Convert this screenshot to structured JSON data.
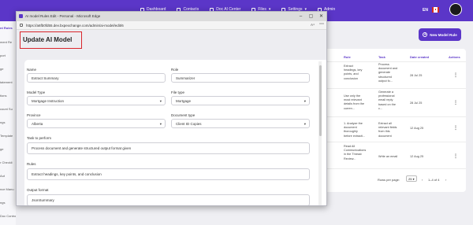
{
  "topnav": {
    "items": [
      "Dashboard",
      "Contacts",
      "Doc AI Center",
      "Files",
      "Settings",
      "Admin"
    ],
    "language": "EN"
  },
  "sidebar": {
    "items": [
      "nt Rules",
      "ment Re",
      "port",
      "ge",
      "tatement",
      "tions",
      "count Su",
      "ngs",
      "Template",
      "ge",
      "r Checkli",
      "Aut",
      "nce Manu",
      "ngs",
      "Doc Control"
    ]
  },
  "main": {
    "new_rule_label": "New Model Rule",
    "columns": [
      "Rule",
      "Task",
      "Date created",
      "Actions"
    ],
    "rows": [
      {
        "rule": "Extract\nheadings, key\npoints, and\nconclusion",
        "task": "Process\ndocument and\ngenerate\nstructured\noutput fo...",
        "date": "28 Jul 25"
      },
      {
        "rule": "Use only the\nmost relevant\ndetails from the\ncurren...",
        "task": "Generate a\nprofessional\nemail reply\nbased on the\nc...",
        "date": "28 Jul 25"
      },
      {
        "rule": "1. Analyze the\ndocument\nthoroughly\nbefore extracti...",
        "task": "Extract all\nrelevant fields\nfrom this\ndocument",
        "date": "12 Aug 25"
      },
      {
        "rule": "Read All\nCommunications\nin the Thread:\nReview...",
        "task": "Write an email",
        "date": "12 Aug 25"
      }
    ],
    "pager": {
      "rows_per_page_label": "Rows per page:",
      "rows_per_page": "25",
      "range": "1–4 of 4"
    }
  },
  "popup": {
    "window_title": "AI model Rules Edit - Personal - Microsoft Edge",
    "url": "https://a6fb0fd55.dev.bxpexchange.com/admin/ai-model/edit/6",
    "reader_label": "A⁴",
    "heading": "Update AI Model",
    "form": {
      "name_label": "Name",
      "name_value": "Extract Summary",
      "role_label": "Role",
      "role_value": "Summarizer",
      "model_type_label": "Model Type",
      "model_type_value": "Mortgage Instruction",
      "file_type_label": "File type",
      "file_type_value": "Mortgage",
      "province_label": "Province",
      "province_value": "Alberta",
      "document_type_label": "Document type",
      "document_type_value": "Client ID Copies",
      "task_label": "Task to perform",
      "task_value": "Process document and generate structured output format given",
      "rules_label": "Rules",
      "rules_value": "Extract headings, key points, and conclusion",
      "output_format_label": "Output format",
      "output_format_value": "JsonSummary"
    }
  },
  "colors": {
    "brand": "#5b36c8",
    "highlight_border": "#d9262c"
  }
}
